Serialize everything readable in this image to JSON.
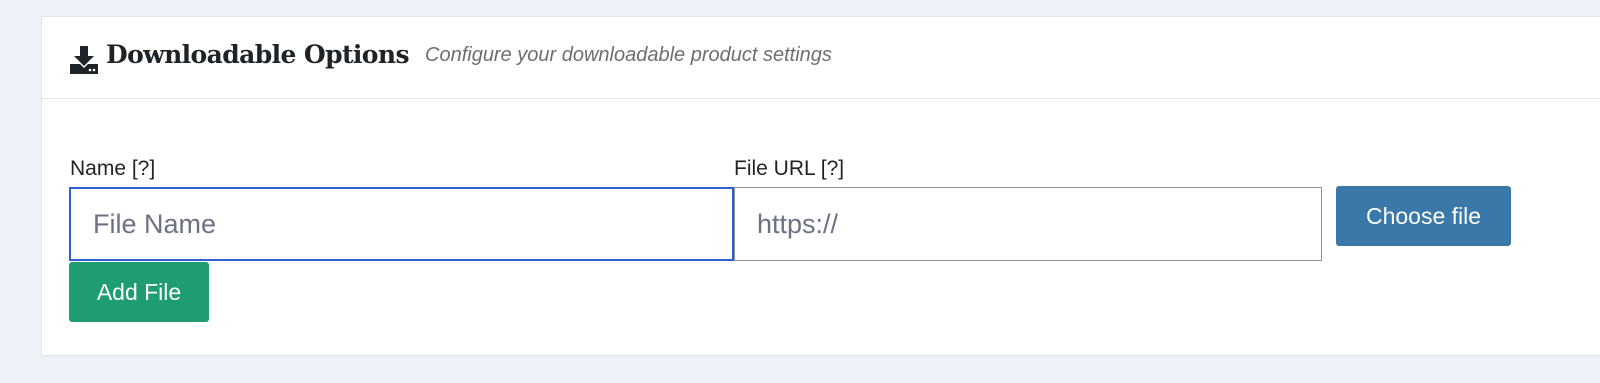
{
  "colors": {
    "page_background": "#eef2f8",
    "focus_border": "#2f5fd0",
    "choose_button": "#3a78aa",
    "add_button": "#1e9d73"
  },
  "header": {
    "icon": "download-icon",
    "title": "Downloadable Options",
    "subtitle": "Configure your downloadable product settings"
  },
  "form": {
    "name_label": "Name [?]",
    "name_placeholder": "File Name",
    "name_value": "",
    "url_label": "File URL [?]",
    "url_placeholder": "https://",
    "url_value": "",
    "choose_file_label": "Choose file",
    "add_file_label": "Add File"
  }
}
